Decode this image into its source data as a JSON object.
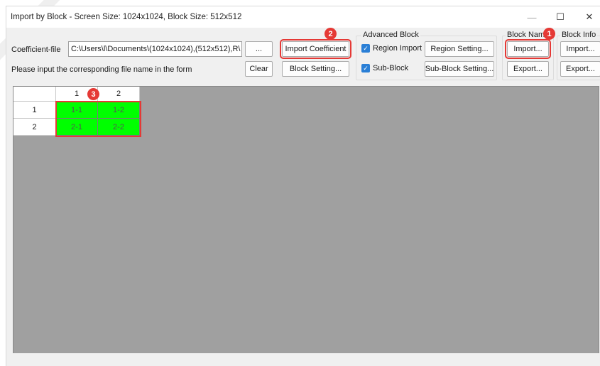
{
  "window": {
    "title": "Import by Block - Screen Size: 1024x1024,  Block Size:  512x512",
    "controls": {
      "minimize": "—",
      "maximize": "☐",
      "close": "✕"
    }
  },
  "coefficient": {
    "label": "Coefficient-file",
    "value": "C:\\Users\\l\\Documents\\(1024x1024),(512x512),R\\",
    "browse_label": "...",
    "import_label": "Import Coefficient"
  },
  "hint": "Please input the corresponding file name in the form",
  "clear_label": "Clear",
  "block_setting_label": "Block Setting...",
  "advanced": {
    "title": "Advanced Block",
    "region_import_label": "Region Import",
    "region_setting_label": "Region Setting...",
    "sub_block_label": "Sub-Block",
    "sub_block_setting_label": "Sub-Block Setting..."
  },
  "block_name": {
    "title": "Block Nam",
    "import_label": "Import...",
    "export_label": "Export..."
  },
  "block_info": {
    "title": "Block Info",
    "import_label": "Import...",
    "export_label": "Export..."
  },
  "badges": {
    "one": "1",
    "two": "2",
    "three": "3"
  },
  "table": {
    "columns": [
      "1",
      "2"
    ],
    "rows": [
      {
        "header": "1",
        "cells": [
          "1-1",
          "1-2"
        ]
      },
      {
        "header": "2",
        "cells": [
          "2-1",
          "2-2"
        ]
      }
    ]
  },
  "colors": {
    "accent_red": "#e53935",
    "cell_green": "#00ff00",
    "checkbox_blue": "#2a7fd6",
    "grid_gray": "#a0a0a0"
  }
}
